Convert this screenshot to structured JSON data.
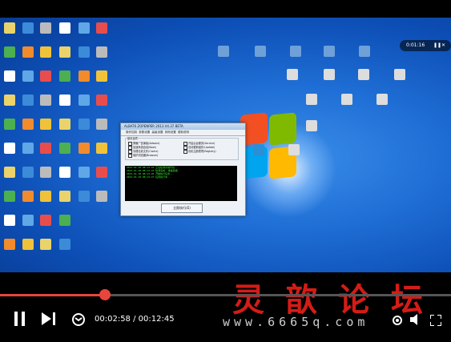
{
  "player": {
    "current_time": "00:02:58",
    "separator": " / ",
    "total_time": "00:12:45",
    "progress_fraction": 0.233,
    "top_pill_text": "0:01:16",
    "accent": "#e8453c"
  },
  "watermark": {
    "chinese": "灵歆论坛",
    "url": "www.6665q.com"
  },
  "dialog": {
    "title": "ALBAT6 ZOPENPER 2013 V4.37 BETA",
    "tabs": [
      "操作控制",
      "参数设置",
      "高级设置",
      "其他设置",
      "更新说明"
    ],
    "group_title": "基本选项",
    "options_left": [
      "屏蔽广告弹窗(Adware)",
      "加速系统启动(Boot)",
      "清理垃圾文件(Cache)",
      "保护浏览器(Browser)"
    ],
    "options_right": [
      "开启后台服务(Service)",
      "自动更新组件(Update)",
      "优化注册表项(Registry)"
    ],
    "console_lines": [
      "2013-01-18 08:13:22  正在检测系统环境...",
      "2013-01-18 08:13:23  检测完成, 准备就绪",
      "2013-01-18 08:13:25  开始执行任务...",
      "2013-01-18 08:13:27  任务执行中..."
    ],
    "button": "立即执行(E)"
  },
  "desktop": {
    "icons": [
      "computer-icon",
      "recycle-bin-icon",
      "folder-icon",
      "app-icon",
      "app-icon",
      "chess-icon",
      "document-icon",
      "shield-icon",
      "network-icon",
      "app-icon",
      "browser-icon",
      "document-icon",
      "document-icon",
      "app-icon"
    ]
  }
}
